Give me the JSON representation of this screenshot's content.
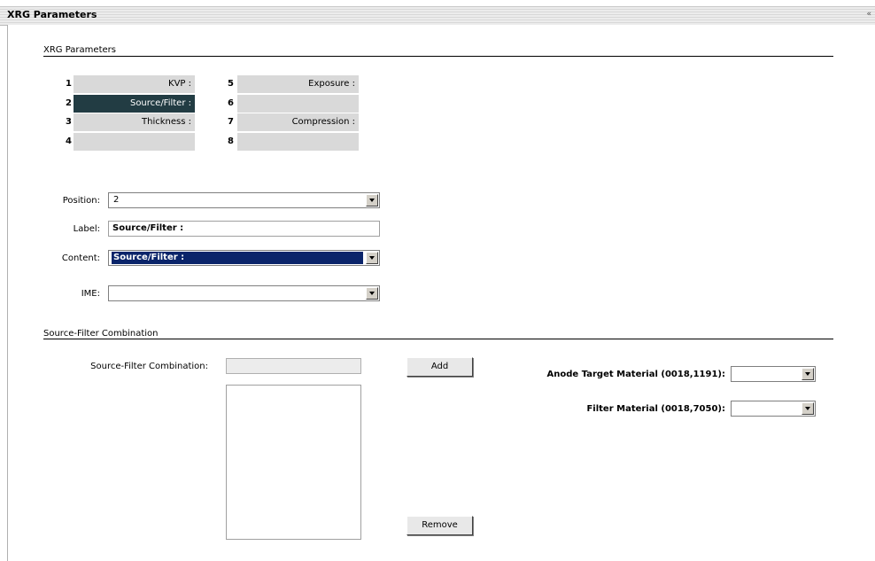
{
  "header": {
    "title": "XRG Parameters",
    "collapse_icon": "«"
  },
  "xrg_section": {
    "label": "XRG Parameters"
  },
  "grid": {
    "left": [
      {
        "num": "1",
        "label": "KVP :",
        "selected": false
      },
      {
        "num": "2",
        "label": "Source/Filter :",
        "selected": true
      },
      {
        "num": "3",
        "label": "Thickness :",
        "selected": false
      },
      {
        "num": "4",
        "label": "",
        "selected": false
      }
    ],
    "right": [
      {
        "num": "5",
        "label": "Exposure :",
        "selected": false
      },
      {
        "num": "6",
        "label": "",
        "selected": false
      },
      {
        "num": "7",
        "label": "Compression :",
        "selected": false
      },
      {
        "num": "8",
        "label": "",
        "selected": false
      }
    ],
    "selected_color": "#223c43",
    "cell_color": "#d9d9d9"
  },
  "form": {
    "position": {
      "label": "Position:",
      "value": "2"
    },
    "label_field": {
      "label": "Label:",
      "value": "Source/Filter :"
    },
    "content": {
      "label": "Content:",
      "value": "Source/Filter :"
    },
    "ime": {
      "label": "IME:",
      "value": ""
    }
  },
  "sf_section": {
    "label": "Source-Filter Combination",
    "combo_label": "Source-Filter Combination:",
    "add_label": "Add",
    "remove_label": "Remove",
    "anode": {
      "label": "Anode Target Material (0018,1191):",
      "value": ""
    },
    "filter": {
      "label": "Filter Material (0018,7050):",
      "value": ""
    }
  }
}
